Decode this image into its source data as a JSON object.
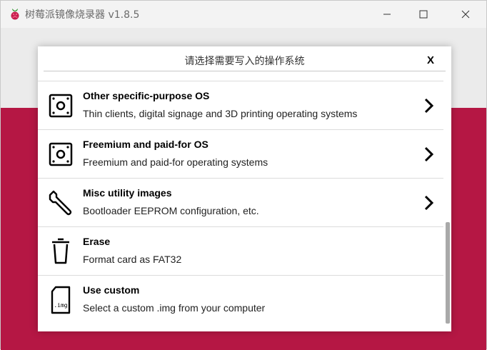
{
  "window": {
    "title": "树莓派镜像烧录器 v1.8.5"
  },
  "dialog": {
    "title": "请选择需要写入的操作系统",
    "close_label": "X"
  },
  "os_list": [
    {
      "name": "Other specific-purpose OS",
      "description": "Thin clients, digital signage and 3D printing operating systems",
      "icon": "sd-card-icon",
      "has_submenu": true
    },
    {
      "name": "Freemium and paid-for OS",
      "description": "Freemium and paid-for operating systems",
      "icon": "sd-card-icon",
      "has_submenu": true
    },
    {
      "name": "Misc utility images",
      "description": "Bootloader EEPROM configuration, etc.",
      "icon": "wrench-icon",
      "has_submenu": true
    },
    {
      "name": "Erase",
      "description": "Format card as FAT32",
      "icon": "trash-icon",
      "has_submenu": false
    },
    {
      "name": "Use custom",
      "description": "Select a custom .img from your computer",
      "icon": "img-file-icon",
      "img_label": ".img",
      "has_submenu": false
    }
  ],
  "colors": {
    "brand": "#c51a4a",
    "titlebar": "#f3f3f3"
  }
}
